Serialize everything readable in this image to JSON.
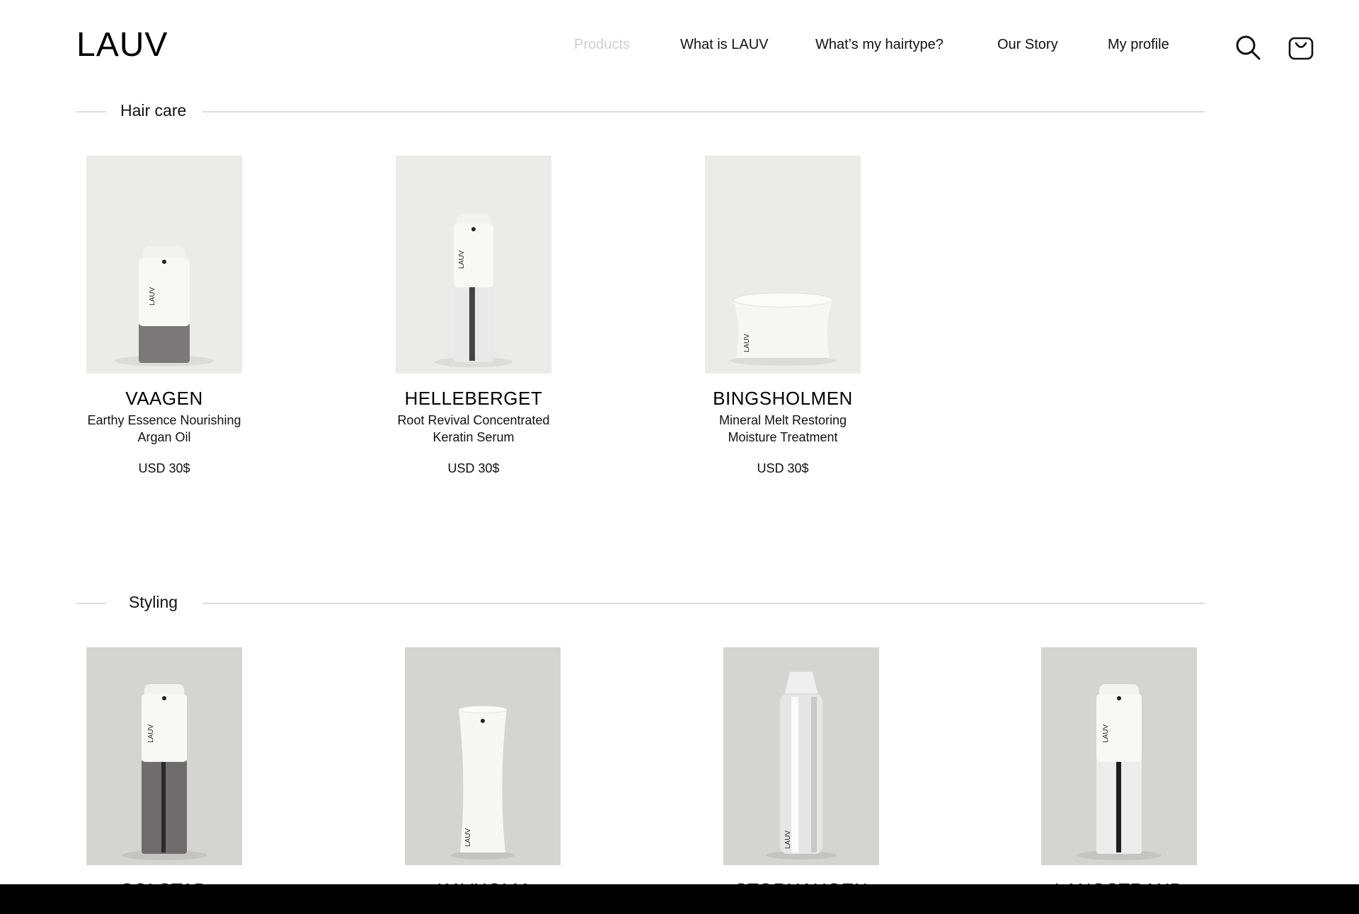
{
  "brand": {
    "logo": "LAUV"
  },
  "nav": {
    "items": [
      {
        "label": "Products",
        "state": "current"
      },
      {
        "label": "What is LAUV"
      },
      {
        "label": "What’s my hairtype?"
      },
      {
        "label": "Our Story"
      },
      {
        "label": "My profile"
      }
    ]
  },
  "header_icons": [
    "search-icon",
    "shopping-bag-icon"
  ],
  "sections": [
    {
      "title": "Hair care",
      "products": [
        {
          "name": "VAAGEN",
          "desc_line1": "Earthy Essence Nourishing",
          "desc_line2": "Argan Oil",
          "price": "USD 30$"
        },
        {
          "name": "HELLEBERGET",
          "desc_line1": "Root Revival Concentrated",
          "desc_line2": "Keratin Serum",
          "price": "USD 30$"
        },
        {
          "name": "BINGSHOLMEN",
          "desc_line1": "Mineral Melt Restoring",
          "desc_line2": "Moisture Treatment",
          "price": "USD 30$"
        }
      ]
    },
    {
      "title": "Styling",
      "products": [
        {
          "name": "SOLSTAD"
        },
        {
          "name": "KAVHOLM"
        },
        {
          "name": "STORHAUGEN"
        },
        {
          "name": "LANGSTRAND"
        }
      ]
    }
  ],
  "colors": {
    "page_bg": "#ffffff",
    "nav_current": "#cfcfcf",
    "product_bg_light": "#ebebe9",
    "product_bg_grey": "#d4d4d3",
    "bottom_bar": "#000000"
  }
}
